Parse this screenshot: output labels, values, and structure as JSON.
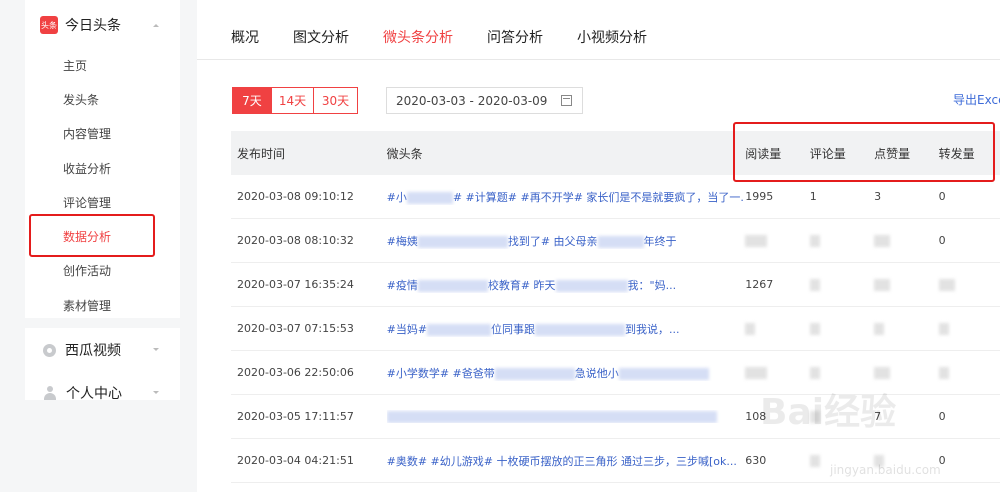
{
  "sidebar": {
    "toutiao": {
      "logo_text": "头条",
      "title": "今日头条",
      "items": [
        {
          "label": "主页"
        },
        {
          "label": "发头条"
        },
        {
          "label": "内容管理"
        },
        {
          "label": "收益分析"
        },
        {
          "label": "评论管理"
        },
        {
          "label": "数据分析"
        },
        {
          "label": "创作活动"
        },
        {
          "label": "素材管理"
        }
      ]
    },
    "xigua": {
      "title": "西瓜视频"
    },
    "personal": {
      "title": "个人中心"
    }
  },
  "tabs": [
    {
      "label": "概况"
    },
    {
      "label": "图文分析"
    },
    {
      "label": "微头条分析"
    },
    {
      "label": "问答分析"
    },
    {
      "label": "小视频分析"
    }
  ],
  "range_buttons": [
    {
      "label": "7天"
    },
    {
      "label": "14天"
    },
    {
      "label": "30天"
    }
  ],
  "date_range": "2020-03-03 - 2020-03-09",
  "export_label": "导出Excel",
  "table": {
    "headers": {
      "time": "发布时间",
      "text": "微头条",
      "reads": "阅读量",
      "comments": "评论量",
      "likes": "点赞量",
      "shares": "转发量"
    },
    "rows": [
      {
        "time": "2020-03-08 09:10:12",
        "text_a": "#小",
        "text_b": "# #计算题# #再不开学# 家长们是不是就要疯了，当了一...",
        "reads": "1995",
        "comments": "1",
        "likes": "3",
        "shares": "0"
      },
      {
        "time": "2020-03-08 08:10:32",
        "text_a": "#梅姨",
        "text_b": "找到了# 由父母亲",
        "text_c": "年终于",
        "reads": "",
        "comments": "",
        "likes": "",
        "shares": "0"
      },
      {
        "time": "2020-03-07 16:35:24",
        "text_a": "#疫情",
        "text_b": "校教育# 昨天",
        "text_c": "我：\"妈...",
        "reads": "1267",
        "comments": "",
        "likes": "",
        "shares": ""
      },
      {
        "time": "2020-03-07 07:15:53",
        "text_a": "#当妈#",
        "text_b": "位同事跟",
        "text_c": "到我说，...",
        "reads": "",
        "comments": "",
        "likes": "",
        "shares": ""
      },
      {
        "time": "2020-03-06 22:50:06",
        "text_a": "#小学数学# #爸爸带",
        "text_b": "急说他小",
        "reads": "",
        "comments": "",
        "likes": "",
        "shares": ""
      },
      {
        "time": "2020-03-05 17:11:57",
        "text_a": "",
        "reads": "108",
        "comments": "",
        "likes": "7",
        "shares": "0"
      },
      {
        "time": "2020-03-04 04:21:51",
        "text_a": "#奥数# #幼儿游戏# 十枚硬币摆放的正三角形 通过三步，三步喊[ok...",
        "reads": "630",
        "comments": "",
        "likes": "",
        "shares": "0"
      }
    ]
  },
  "watermark": {
    "text": "Bai经验",
    "url": "jingyan.baidu.com"
  },
  "colors": {
    "accent": "#f04142",
    "link": "#3a62c8",
    "highlight": "#e41c1c"
  }
}
